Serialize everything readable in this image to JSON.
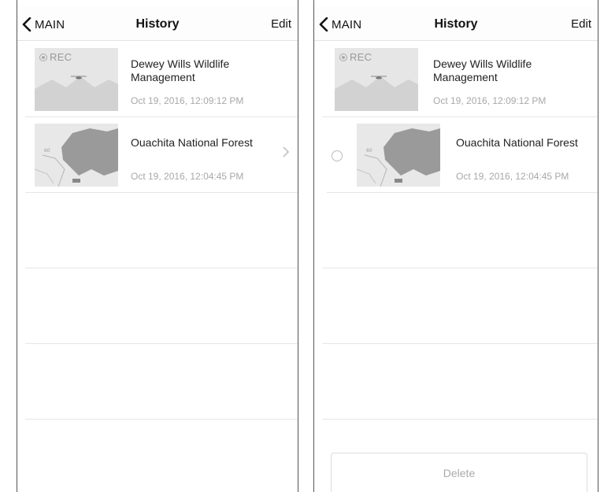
{
  "left": {
    "navbar": {
      "back_label": "MAIN",
      "title": "History",
      "edit_label": "Edit"
    },
    "items": [
      {
        "title": "Dewey Wills Wildlife Management",
        "date": "Oct 19, 2016, 12:09:12 PM",
        "badge": "REC"
      },
      {
        "title": "Ouachita National Forest",
        "date": "Oct 19, 2016, 12:04:45 PM"
      }
    ]
  },
  "right": {
    "navbar": {
      "back_label": "MAIN",
      "title": "History",
      "edit_label": "Edit"
    },
    "items": [
      {
        "title": "Dewey Wills Wildlife Management",
        "date": "Oct 19, 2016, 12:09:12 PM",
        "badge": "REC"
      },
      {
        "title": "Ouachita National Forest",
        "date": "Oct 19, 2016, 12:04:45 PM"
      }
    ],
    "delete_label": "Delete"
  },
  "colors": {
    "border": "#555555",
    "divider": "#e6e6e6",
    "muted_text": "#a8a8a8",
    "thumb_bg": "#e5e5e5"
  },
  "icons": [
    "back-chevron-icon",
    "rec-indicator-icon",
    "chevron-right-icon",
    "selection-circle-icon"
  ]
}
